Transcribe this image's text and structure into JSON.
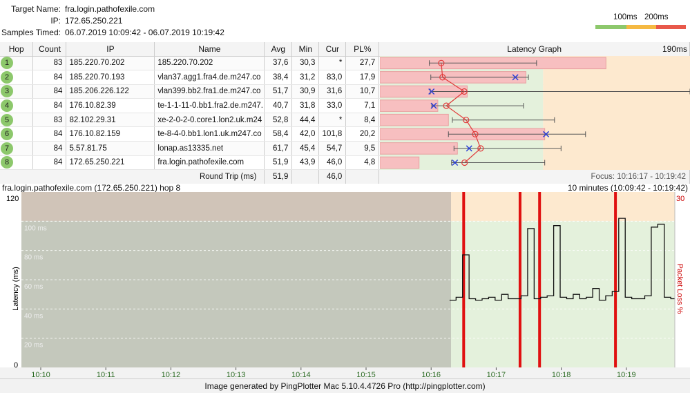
{
  "info": {
    "target_label": "Target Name:",
    "target_value": "fra.login.pathofexile.com",
    "ip_label": "IP:",
    "ip_value": "172.65.250.221",
    "samples_label": "Samples Timed:",
    "samples_value": "06.07.2019 10:09:42 - 06.07.2019 10:19:42"
  },
  "legend": {
    "label_100": "100ms",
    "label_200": "200ms",
    "colors": [
      "#8dc86c",
      "#f5b942",
      "#e8584a"
    ]
  },
  "table": {
    "headers": {
      "hop": "Hop",
      "count": "Count",
      "ip": "IP",
      "name": "Name",
      "avg": "Avg",
      "min": "Min",
      "cur": "Cur",
      "pl": "PL%",
      "graph": "Latency Graph",
      "graph_max": "190ms"
    },
    "rows": [
      {
        "hop": "1",
        "count": "83",
        "ip": "185.220.70.202",
        "name": "185.220.70.202",
        "avg": "37,6",
        "min": "30,3",
        "cur": "*",
        "pl": "27,7"
      },
      {
        "hop": "2",
        "count": "84",
        "ip": "185.220.70.193",
        "name": "vlan37.agg1.fra4.de.m247.co",
        "avg": "38,4",
        "min": "31,2",
        "cur": "83,0",
        "pl": "17,9"
      },
      {
        "hop": "3",
        "count": "84",
        "ip": "185.206.226.122",
        "name": "vlan399.bb2.fra1.de.m247.co",
        "avg": "51,7",
        "min": "30,9",
        "cur": "31,6",
        "pl": "10,7"
      },
      {
        "hop": "4",
        "count": "84",
        "ip": "176.10.82.39",
        "name": "te-1-1-11-0.bb1.fra2.de.m247.",
        "avg": "40,7",
        "min": "31,8",
        "cur": "33,0",
        "pl": "7,1"
      },
      {
        "hop": "5",
        "count": "83",
        "ip": "82.102.29.31",
        "name": "xe-2-0-2-0.core1.lon2.uk.m24",
        "avg": "52,8",
        "min": "44,4",
        "cur": "*",
        "pl": "8,4"
      },
      {
        "hop": "6",
        "count": "84",
        "ip": "176.10.82.159",
        "name": "te-8-4-0.bb1.lon1.uk.m247.co",
        "avg": "58,4",
        "min": "42,0",
        "cur": "101,8",
        "pl": "20,2"
      },
      {
        "hop": "7",
        "count": "84",
        "ip": "5.57.81.75",
        "name": "lonap.as13335.net",
        "avg": "61,7",
        "min": "45,4",
        "cur": "54,7",
        "pl": "9,5"
      },
      {
        "hop": "8",
        "count": "84",
        "ip": "172.65.250.221",
        "name": "fra.login.pathofexile.com",
        "avg": "51,9",
        "min": "43,9",
        "cur": "46,0",
        "pl": "4,8"
      }
    ],
    "round_trip_label": "Round Trip (ms)",
    "round_trip_avg": "51,9",
    "round_trip_cur": "46,0",
    "focus": "Focus: 10:16:17 - 10:19:42"
  },
  "latency_graph": {
    "max_ms": 190,
    "rows": [
      {
        "avg": 37.6,
        "min": 30.3,
        "max": 96,
        "pl": 27.7,
        "cur": null
      },
      {
        "avg": 38.4,
        "min": 31.2,
        "max": 91,
        "pl": 17.9,
        "cur": 83.0
      },
      {
        "avg": 51.7,
        "min": 30.9,
        "max": 190,
        "pl": 10.7,
        "cur": 31.6
      },
      {
        "avg": 40.7,
        "min": 31.8,
        "max": 88,
        "pl": 7.1,
        "cur": 33.0
      },
      {
        "avg": 52.8,
        "min": 44.4,
        "max": 107,
        "pl": 8.4,
        "cur": null
      },
      {
        "avg": 58.4,
        "min": 42.0,
        "max": 126,
        "pl": 20.2,
        "cur": 101.8
      },
      {
        "avg": 61.7,
        "min": 45.4,
        "max": 111,
        "pl": 9.5,
        "cur": 54.7
      },
      {
        "avg": 51.9,
        "min": 43.9,
        "max": 101,
        "pl": 4.8,
        "cur": 46.0
      }
    ]
  },
  "history": {
    "title": "fra.login.pathofexile.com (172.65.250.221) hop 8",
    "range": "10 minutes (10:09:42 - 10:19:42)",
    "y_axis_label": "Latency (ms)",
    "pl_axis_label": "Packet Loss %",
    "y_max": "120",
    "y_min": "0",
    "pl_max": "30",
    "ms_labels": [
      "100 ms",
      "80 ms",
      "60 ms",
      "40 ms",
      "20 ms"
    ],
    "time_labels": [
      "10:10",
      "10:11",
      "10:12",
      "10:13",
      "10:14",
      "10:15",
      "10:16",
      "10:17",
      "10:18",
      "10:19"
    ]
  },
  "chart_data": {
    "type": "line",
    "title": "fra.login.pathofexile.com (172.65.250.221) hop 8",
    "xlabel": "",
    "ylabel": "Latency (ms)",
    "ylim": [
      0,
      120
    ],
    "series": [
      {
        "x": [
          "10:16:17",
          "10:16:23",
          "10:16:29",
          "10:16:35",
          "10:16:41",
          "10:16:47",
          "10:16:53",
          "10:16:59",
          "10:17:05",
          "10:17:11",
          "10:17:17",
          "10:17:23",
          "10:17:29",
          "10:17:35",
          "10:17:41",
          "10:17:47",
          "10:17:53",
          "10:17:59",
          "10:18:05",
          "10:18:11",
          "10:18:17",
          "10:18:23",
          "10:18:29",
          "10:18:35",
          "10:18:41",
          "10:18:47",
          "10:18:53",
          "10:18:59",
          "10:19:05",
          "10:19:11",
          "10:19:17",
          "10:19:23",
          "10:19:29",
          "10:19:35",
          "10:19:41"
        ],
        "y": [
          46,
          48,
          77,
          47,
          46,
          47,
          48,
          46,
          50,
          47,
          47,
          49,
          95,
          47,
          48,
          49,
          97,
          48,
          47,
          50,
          47,
          48,
          54,
          46,
          49,
          52,
          102,
          48,
          47,
          47,
          49,
          96,
          98,
          48,
          47
        ]
      }
    ],
    "packet_loss_times": [
      "10:16:30",
      "10:17:22",
      "10:17:40",
      "10:18:50"
    ]
  }
}
